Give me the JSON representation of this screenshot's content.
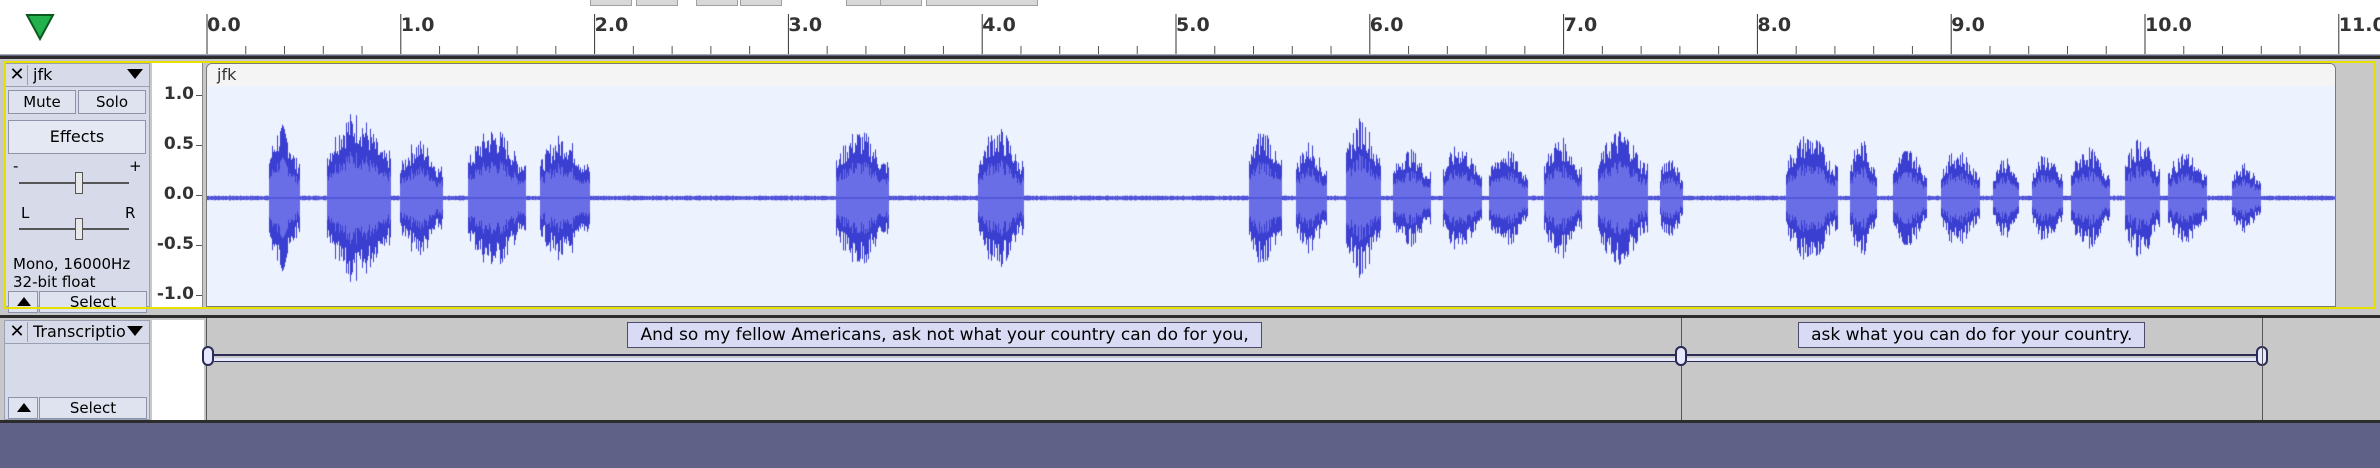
{
  "ruler": {
    "labels": [
      "0.0",
      "1.0",
      "2.0",
      "3.0",
      "4.0",
      "5.0",
      "6.0",
      "7.0",
      "8.0",
      "9.0",
      "10.0",
      "11.0"
    ]
  },
  "audio_track": {
    "name": "jfk",
    "mute_label": "Mute",
    "solo_label": "Solo",
    "effects_label": "Effects",
    "gain_minus": "-",
    "gain_plus": "+",
    "pan_left": "L",
    "pan_right": "R",
    "format_line1": "Mono, 16000Hz",
    "format_line2": "32-bit float",
    "select_label": "Select",
    "clip_name": "jfk",
    "vscale": [
      "1.0",
      "0.5",
      "0.0",
      "-0.5",
      "-1.0"
    ]
  },
  "label_track": {
    "name": "Transcriptio",
    "select_label": "Select",
    "labels": [
      {
        "text": "And so my fellow Americans, ask not what your country can do for you,",
        "start": 0.0,
        "end": 7.6
      },
      {
        "text": "ask what you can do for your country.",
        "start": 7.6,
        "end": 10.6
      }
    ]
  },
  "colors": {
    "waveform": "#3b3fd1",
    "waveform_rms": "#6a6ee6",
    "clip_bg": "#edf2ff",
    "focus": "#e6e000"
  },
  "icons": {
    "play_head": "green-triangle-down-icon",
    "close": "close-icon",
    "menu": "dropdown-arrow-icon",
    "collapse": "collapse-up-icon"
  }
}
